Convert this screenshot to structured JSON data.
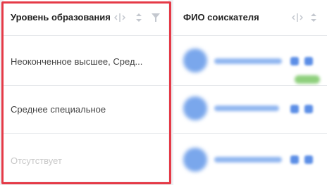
{
  "table": {
    "education_column": {
      "header": "Уровень образования",
      "rows": [
        "Неоконченное высшее, Сред...",
        "Среднее специальное",
        "Отсутствует"
      ]
    },
    "fio_column": {
      "header": "ФИО соискателя"
    }
  },
  "colors": {
    "highlight": "#e53a47",
    "accent": "#5b8ee6"
  },
  "icons": [
    "resize-icon",
    "sort-icon",
    "filter-icon",
    "edit-icon",
    "open-link-icon"
  ]
}
